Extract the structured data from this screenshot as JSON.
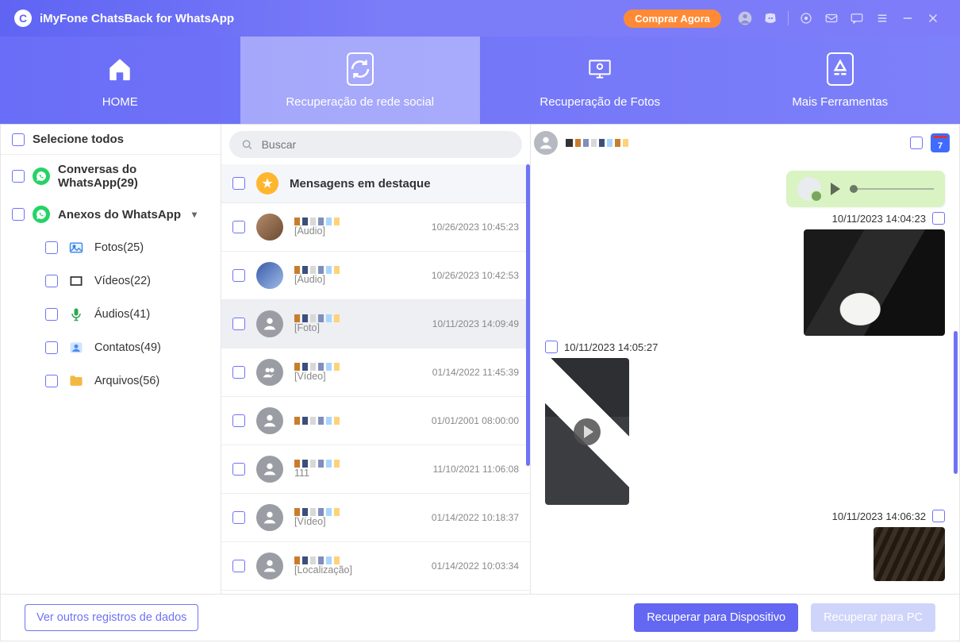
{
  "app": {
    "title": "iMyFone ChatsBack for WhatsApp"
  },
  "titlebar": {
    "buy_label": "Comprar Agora"
  },
  "tabs": {
    "home": "HOME",
    "social": "Recuperação de rede social",
    "photos": "Recuperação de Fotos",
    "tools": "Mais Ferramentas"
  },
  "sidebar": {
    "select_all": "Selecione todos",
    "conversations": {
      "label": "Conversas do WhatsApp",
      "count": 29
    },
    "attachments": {
      "label": "Anexos do WhatsApp"
    },
    "items": [
      {
        "label": "Fotos",
        "count": 25,
        "icon": "photo"
      },
      {
        "label": "Vídeos",
        "count": 22,
        "icon": "video"
      },
      {
        "label": "Áudios",
        "count": 41,
        "icon": "mic"
      },
      {
        "label": "Contatos",
        "count": 49,
        "icon": "contact"
      },
      {
        "label": "Arquivos",
        "count": 56,
        "icon": "folder"
      }
    ]
  },
  "search": {
    "placeholder": "Buscar"
  },
  "list": {
    "header": "Mensagens em destaque",
    "items": [
      {
        "name": "+▓▒░",
        "sub": "[Áudio]",
        "ts": "10/26/2023 10:45:23",
        "avatar": "photo1"
      },
      {
        "name": "▓▒░",
        "sub": "[Áudio]",
        "ts": "10/26/2023 10:42:53",
        "avatar": "photo2"
      },
      {
        "name": "░▒▓",
        "sub": "[Foto]",
        "ts": "10/11/2023 14:09:49",
        "avatar": "person",
        "selected": true
      },
      {
        "name": "▒░",
        "sub": "[Vídeo]",
        "ts": "01/14/2022 11:45:39",
        "avatar": "group"
      },
      {
        "name": "+▓▒░ .",
        "sub": "",
        "ts": "01/01/2001 08:00:00",
        "avatar": "person"
      },
      {
        "name": "+▓░▒ ..",
        "sub": "111",
        "ts": "11/10/2021 11:06:08",
        "avatar": "person"
      },
      {
        "name": "▓▒░▒",
        "sub": "[Vídeo]",
        "ts": "01/14/2022 10:18:37",
        "avatar": "person"
      },
      {
        "name": "▓▒░░",
        "sub": "[Localização]",
        "ts": "01/14/2022 10:03:34",
        "avatar": "person"
      }
    ]
  },
  "chat": {
    "contact": "+▓▒░▒▓",
    "calendar_day": "7",
    "messages": [
      {
        "side": "right",
        "type": "audio"
      },
      {
        "side": "right",
        "type": "ts",
        "text": "10/11/2023 14:04:23"
      },
      {
        "side": "right",
        "type": "image-cat"
      },
      {
        "side": "left",
        "type": "ts",
        "text": "10/11/2023 14:05:27"
      },
      {
        "side": "left",
        "type": "video"
      },
      {
        "side": "right",
        "type": "ts",
        "text": "10/11/2023 14:06:32"
      },
      {
        "side": "right",
        "type": "image-misc"
      }
    ]
  },
  "footer": {
    "other_logs": "Ver outros registros de dados",
    "recover_device": "Recuperar para Dispositivo",
    "recover_pc": "Recuperar para PC"
  }
}
